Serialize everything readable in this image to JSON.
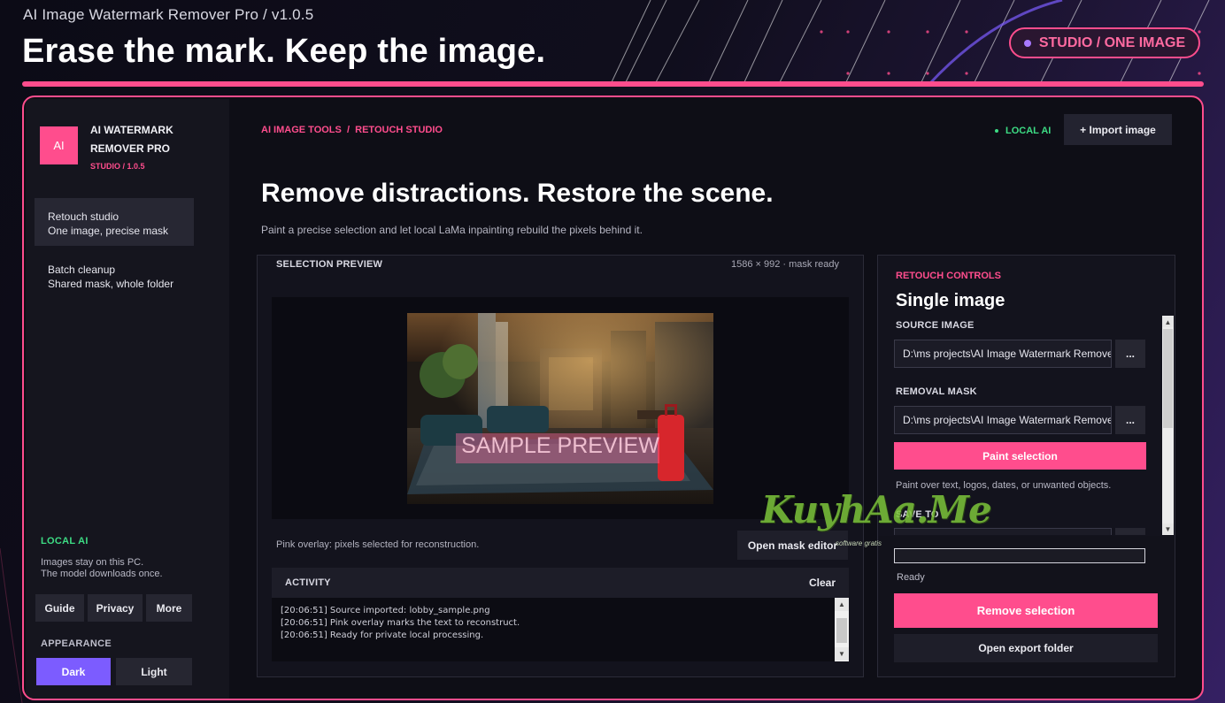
{
  "window": {
    "title": "AI Image Watermark Remover Pro  /  v1.0.5"
  },
  "hero": {
    "headline": "Erase the mark. Keep the image.",
    "badge": "STUDIO / ONE IMAGE"
  },
  "sidebar": {
    "logo": "AI",
    "brand_line1": "AI WATERMARK",
    "brand_line2": "REMOVER PRO",
    "brand_sub": "STUDIO  /  1.0.5",
    "nav": [
      {
        "title": "Retouch studio",
        "subtitle": "One image, precise mask",
        "active": true
      },
      {
        "title": "Batch cleanup",
        "subtitle": "Shared mask, whole folder",
        "active": false
      }
    ],
    "local_ai": {
      "title": "LOCAL AI",
      "line1": "Images stay on this PC.",
      "line2": "The model downloads once."
    },
    "links": [
      "Guide",
      "Privacy",
      "More"
    ],
    "appearance": {
      "title": "APPEARANCE",
      "options": [
        "Dark",
        "Light"
      ],
      "selected": "Dark"
    }
  },
  "header": {
    "breadcrumb": [
      "AI IMAGE TOOLS",
      "RETOUCH STUDIO"
    ],
    "status": "LOCAL AI",
    "import_label": "+ Import image",
    "title": "Remove distractions. Restore the scene.",
    "subtitle": "Paint a precise selection and let local LaMa inpainting rebuild the pixels behind it."
  },
  "preview": {
    "title": "SELECTION PREVIEW",
    "meta": "1586 × 992  ·  mask ready",
    "overlay_text": "SAMPLE PREVIEW",
    "caption": "Pink overlay: pixels selected for reconstruction.",
    "open_mask_label": "Open mask editor"
  },
  "activity": {
    "title": "ACTIVITY",
    "clear_label": "Clear",
    "lines": [
      "[20:06:51]  Source imported: lobby_sample.png",
      "[20:06:51]  Pink overlay marks the text to reconstruct.",
      "[20:06:51]  Ready for private local processing."
    ]
  },
  "controls": {
    "eyebrow": "RETOUCH CONTROLS",
    "title": "Single image",
    "source_label": "SOURCE IMAGE",
    "source_value": "D:\\ms projects\\AI Image Watermark Remover",
    "mask_label": "REMOVAL MASK",
    "mask_value": "D:\\ms projects\\AI Image Watermark Remover",
    "browse_label": "...",
    "paint_label": "Paint selection",
    "paint_hint": "Paint over text, logos, dates, or unwanted objects.",
    "save_label": "SAVE TO",
    "progress": 0,
    "status": "Ready",
    "remove_label": "Remove selection",
    "export_label": "Open export folder"
  },
  "watermark": {
    "text": "KuyhAa.Me",
    "sub": "software gratis"
  },
  "colors": {
    "accent": "#ff4d8d",
    "green": "#3ddc84",
    "violet": "#7c5cff"
  },
  "icons": [
    "status-dot-icon",
    "badge-dot-icon",
    "scroll-up-icon",
    "scroll-down-icon"
  ]
}
